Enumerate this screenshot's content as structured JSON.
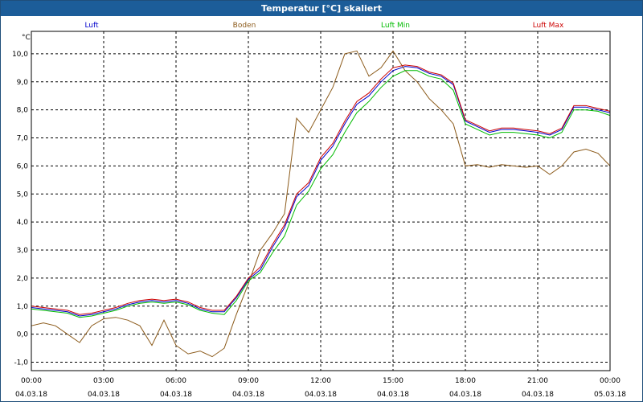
{
  "window": {
    "title": "Temperatur [°C] skaliert"
  },
  "chart_data": {
    "type": "line",
    "ylabel": "°C",
    "xlabel": "",
    "ylim": [
      -1.3,
      10.8
    ],
    "yticks": [
      -1.0,
      0.0,
      1.0,
      2.0,
      3.0,
      4.0,
      5.0,
      6.0,
      7.0,
      8.0,
      9.0,
      10.0
    ],
    "ytick_labels": [
      "-1,0",
      "0,0",
      "1,0",
      "2,0",
      "3,0",
      "4,0",
      "5,0",
      "6,0",
      "7,0",
      "8,0",
      "9,0",
      "10,0"
    ],
    "xlim": [
      0,
      24
    ],
    "xticks": [
      0,
      3,
      6,
      9,
      12,
      15,
      18,
      21,
      24
    ],
    "xtick_labels": [
      [
        "00:00",
        "04.03.18"
      ],
      [
        "03:00",
        "04.03.18"
      ],
      [
        "06:00",
        "04.03.18"
      ],
      [
        "09:00",
        "04.03.18"
      ],
      [
        "12:00",
        "04.03.18"
      ],
      [
        "15:00",
        "04.03.18"
      ],
      [
        "18:00",
        "04.03.18"
      ],
      [
        "21:00",
        "04.03.18"
      ],
      [
        "00:00",
        "05.03.18"
      ]
    ],
    "grid": true,
    "legend_position": "top",
    "series": [
      {
        "name": "Luft",
        "color": "#0000cc",
        "points": [
          [
            0,
            0.95
          ],
          [
            0.5,
            0.9
          ],
          [
            1,
            0.85
          ],
          [
            1.5,
            0.8
          ],
          [
            2,
            0.65
          ],
          [
            2.5,
            0.7
          ],
          [
            3,
            0.8
          ],
          [
            3.5,
            0.9
          ],
          [
            4,
            1.05
          ],
          [
            4.5,
            1.15
          ],
          [
            5,
            1.2
          ],
          [
            5.5,
            1.15
          ],
          [
            6,
            1.2
          ],
          [
            6.5,
            1.1
          ],
          [
            7,
            0.9
          ],
          [
            7.5,
            0.8
          ],
          [
            8,
            0.8
          ],
          [
            8.5,
            1.3
          ],
          [
            9,
            1.95
          ],
          [
            9.5,
            2.3
          ],
          [
            10,
            3.1
          ],
          [
            10.5,
            3.8
          ],
          [
            11,
            4.9
          ],
          [
            11.5,
            5.3
          ],
          [
            12,
            6.2
          ],
          [
            12.5,
            6.7
          ],
          [
            13,
            7.5
          ],
          [
            13.5,
            8.2
          ],
          [
            14,
            8.5
          ],
          [
            14.5,
            9.0
          ],
          [
            15,
            9.4
          ],
          [
            15.5,
            9.55
          ],
          [
            16,
            9.5
          ],
          [
            16.5,
            9.3
          ],
          [
            17,
            9.2
          ],
          [
            17.5,
            8.9
          ],
          [
            18,
            7.6
          ],
          [
            18.5,
            7.4
          ],
          [
            19,
            7.2
          ],
          [
            19.5,
            7.3
          ],
          [
            20,
            7.3
          ],
          [
            20.5,
            7.25
          ],
          [
            21,
            7.2
          ],
          [
            21.5,
            7.1
          ],
          [
            22,
            7.3
          ],
          [
            22.5,
            8.1
          ],
          [
            23,
            8.1
          ],
          [
            23.5,
            8.0
          ],
          [
            24,
            7.9
          ]
        ]
      },
      {
        "name": "Boden",
        "color": "#8b5a1a",
        "points": [
          [
            0,
            0.3
          ],
          [
            0.5,
            0.4
          ],
          [
            1,
            0.3
          ],
          [
            1.5,
            0.0
          ],
          [
            2,
            -0.3
          ],
          [
            2.5,
            0.3
          ],
          [
            3,
            0.55
          ],
          [
            3.5,
            0.6
          ],
          [
            4,
            0.5
          ],
          [
            4.5,
            0.3
          ],
          [
            5,
            -0.4
          ],
          [
            5.5,
            0.5
          ],
          [
            6,
            -0.4
          ],
          [
            6.5,
            -0.7
          ],
          [
            7,
            -0.6
          ],
          [
            7.5,
            -0.8
          ],
          [
            8,
            -0.5
          ],
          [
            8.5,
            0.7
          ],
          [
            9,
            1.8
          ],
          [
            9.5,
            3.0
          ],
          [
            10,
            3.6
          ],
          [
            10.5,
            4.3
          ],
          [
            11,
            7.7
          ],
          [
            11.5,
            7.2
          ],
          [
            12,
            8.0
          ],
          [
            12.5,
            8.8
          ],
          [
            13,
            10.0
          ],
          [
            13.5,
            10.1
          ],
          [
            14,
            9.2
          ],
          [
            14.5,
            9.5
          ],
          [
            15,
            10.1
          ],
          [
            15.5,
            9.4
          ],
          [
            16,
            9.0
          ],
          [
            16.5,
            8.4
          ],
          [
            17,
            8.0
          ],
          [
            17.5,
            7.5
          ],
          [
            18,
            6.0
          ],
          [
            18.5,
            6.05
          ],
          [
            19,
            5.95
          ],
          [
            19.5,
            6.05
          ],
          [
            20,
            6.0
          ],
          [
            20.5,
            5.95
          ],
          [
            21,
            6.0
          ],
          [
            21.5,
            5.7
          ],
          [
            22,
            6.0
          ],
          [
            22.5,
            6.5
          ],
          [
            23,
            6.6
          ],
          [
            23.5,
            6.45
          ],
          [
            24,
            6.0
          ]
        ]
      },
      {
        "name": "Luft Min",
        "color": "#00bb00",
        "points": [
          [
            0,
            0.9
          ],
          [
            0.5,
            0.85
          ],
          [
            1,
            0.8
          ],
          [
            1.5,
            0.75
          ],
          [
            2,
            0.6
          ],
          [
            2.5,
            0.65
          ],
          [
            3,
            0.75
          ],
          [
            3.5,
            0.85
          ],
          [
            4,
            1.0
          ],
          [
            4.5,
            1.1
          ],
          [
            5,
            1.15
          ],
          [
            5.5,
            1.1
          ],
          [
            6,
            1.15
          ],
          [
            6.5,
            1.05
          ],
          [
            7,
            0.85
          ],
          [
            7.5,
            0.75
          ],
          [
            8,
            0.7
          ],
          [
            8.5,
            1.2
          ],
          [
            9,
            1.9
          ],
          [
            9.5,
            2.2
          ],
          [
            10,
            2.9
          ],
          [
            10.5,
            3.5
          ],
          [
            11,
            4.6
          ],
          [
            11.5,
            5.1
          ],
          [
            12,
            5.9
          ],
          [
            12.5,
            6.4
          ],
          [
            13,
            7.2
          ],
          [
            13.5,
            7.9
          ],
          [
            14,
            8.3
          ],
          [
            14.5,
            8.8
          ],
          [
            15,
            9.2
          ],
          [
            15.5,
            9.4
          ],
          [
            16,
            9.4
          ],
          [
            16.5,
            9.2
          ],
          [
            17,
            9.1
          ],
          [
            17.5,
            8.7
          ],
          [
            18,
            7.5
          ],
          [
            18.5,
            7.3
          ],
          [
            19,
            7.1
          ],
          [
            19.5,
            7.2
          ],
          [
            20,
            7.2
          ],
          [
            20.5,
            7.15
          ],
          [
            21,
            7.1
          ],
          [
            21.5,
            7.0
          ],
          [
            22,
            7.2
          ],
          [
            22.5,
            8.0
          ],
          [
            23,
            8.0
          ],
          [
            23.5,
            7.95
          ],
          [
            24,
            7.8
          ]
        ]
      },
      {
        "name": "Luft Max",
        "color": "#cc0000",
        "points": [
          [
            0,
            1.0
          ],
          [
            0.5,
            0.95
          ],
          [
            1,
            0.9
          ],
          [
            1.5,
            0.85
          ],
          [
            2,
            0.7
          ],
          [
            2.5,
            0.75
          ],
          [
            3,
            0.85
          ],
          [
            3.5,
            0.95
          ],
          [
            4,
            1.1
          ],
          [
            4.5,
            1.2
          ],
          [
            5,
            1.25
          ],
          [
            5.5,
            1.2
          ],
          [
            6,
            1.25
          ],
          [
            6.5,
            1.15
          ],
          [
            7,
            0.95
          ],
          [
            7.5,
            0.85
          ],
          [
            8,
            0.85
          ],
          [
            8.5,
            1.35
          ],
          [
            9,
            2.0
          ],
          [
            9.5,
            2.4
          ],
          [
            10,
            3.2
          ],
          [
            10.5,
            3.9
          ],
          [
            11,
            5.0
          ],
          [
            11.5,
            5.4
          ],
          [
            12,
            6.3
          ],
          [
            12.5,
            6.8
          ],
          [
            13,
            7.6
          ],
          [
            13.5,
            8.3
          ],
          [
            14,
            8.6
          ],
          [
            14.5,
            9.1
          ],
          [
            15,
            9.5
          ],
          [
            15.5,
            9.6
          ],
          [
            16,
            9.55
          ],
          [
            16.5,
            9.35
          ],
          [
            17,
            9.25
          ],
          [
            17.5,
            8.95
          ],
          [
            18,
            7.65
          ],
          [
            18.5,
            7.45
          ],
          [
            19,
            7.25
          ],
          [
            19.5,
            7.35
          ],
          [
            20,
            7.35
          ],
          [
            20.5,
            7.3
          ],
          [
            21,
            7.25
          ],
          [
            21.5,
            7.15
          ],
          [
            22,
            7.35
          ],
          [
            22.5,
            8.15
          ],
          [
            23,
            8.15
          ],
          [
            23.5,
            8.05
          ],
          [
            24,
            7.95
          ]
        ]
      }
    ]
  }
}
